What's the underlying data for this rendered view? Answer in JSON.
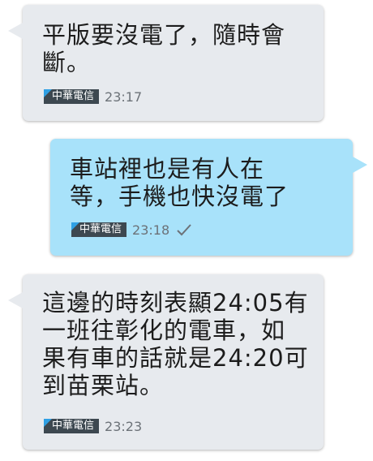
{
  "messages": [
    {
      "direction": "incoming",
      "text": "平版要沒電了，隨時會\n斷。",
      "sim": "中華電信",
      "time": "23:17"
    },
    {
      "direction": "outgoing",
      "text": "車站裡也是有人在\n等，手機也快沒電了",
      "sim": "中華電信",
      "time": "23:18",
      "status_icon": "check-icon"
    },
    {
      "direction": "incoming",
      "text": "這邊的時刻表顯24:05有\n一班往彰化的電車，如\n果有車的話就是24:20可\n到苗栗站。",
      "sim": "中華電信",
      "time": "23:23"
    }
  ],
  "colors": {
    "incoming_bubble": "#e7eaee",
    "outgoing_bubble": "#a8e2fa",
    "sim_badge": "#3d4850",
    "sim_flag": "#2fa0e4"
  }
}
